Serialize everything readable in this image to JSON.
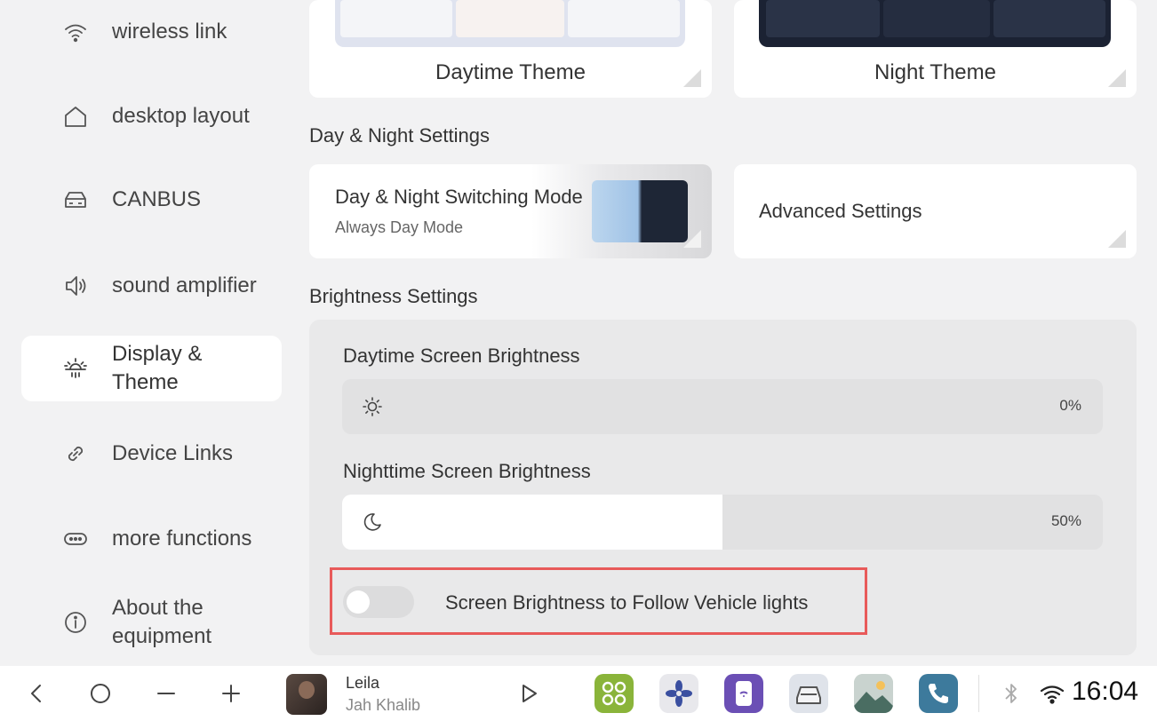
{
  "sidebar": {
    "items": [
      {
        "label": "wireless link",
        "icon": "wifi-icon"
      },
      {
        "label": "desktop layout",
        "icon": "home-icon"
      },
      {
        "label": "CANBUS",
        "icon": "car-icon"
      },
      {
        "label": "sound amplifier",
        "icon": "speaker-icon"
      },
      {
        "label": "Display & Theme",
        "icon": "brightness-icon",
        "active": true
      },
      {
        "label": "Device Links",
        "icon": "link-icon"
      },
      {
        "label": "more functions",
        "icon": "more-icon"
      },
      {
        "label": "About the equipment",
        "icon": "info-icon"
      }
    ]
  },
  "themes": {
    "day_label": "Daytime Theme",
    "night_label": "Night Theme"
  },
  "day_night": {
    "section_title": "Day & Night Settings",
    "switching_title": "Day & Night Switching Mode",
    "switching_value": "Always Day Mode",
    "advanced_label": "Advanced Settings"
  },
  "brightness": {
    "section_title": "Brightness Settings",
    "day_label": "Daytime Screen Brightness",
    "day_value": "0%",
    "day_level": 0,
    "night_label": "Nighttime Screen Brightness",
    "night_value": "50%",
    "night_level": 0.5,
    "follow_label": "Screen Brightness to Follow Vehicle lights",
    "follow_on": false
  },
  "bottombar": {
    "track_title": "Leila",
    "track_artist": "Jah Khalib",
    "time": "16:04"
  },
  "colors": {
    "highlight_border": "#e85a5a",
    "accent_green": "#8ab43a",
    "accent_purple": "#6b4fb5",
    "accent_teal": "#3d7a9c"
  }
}
